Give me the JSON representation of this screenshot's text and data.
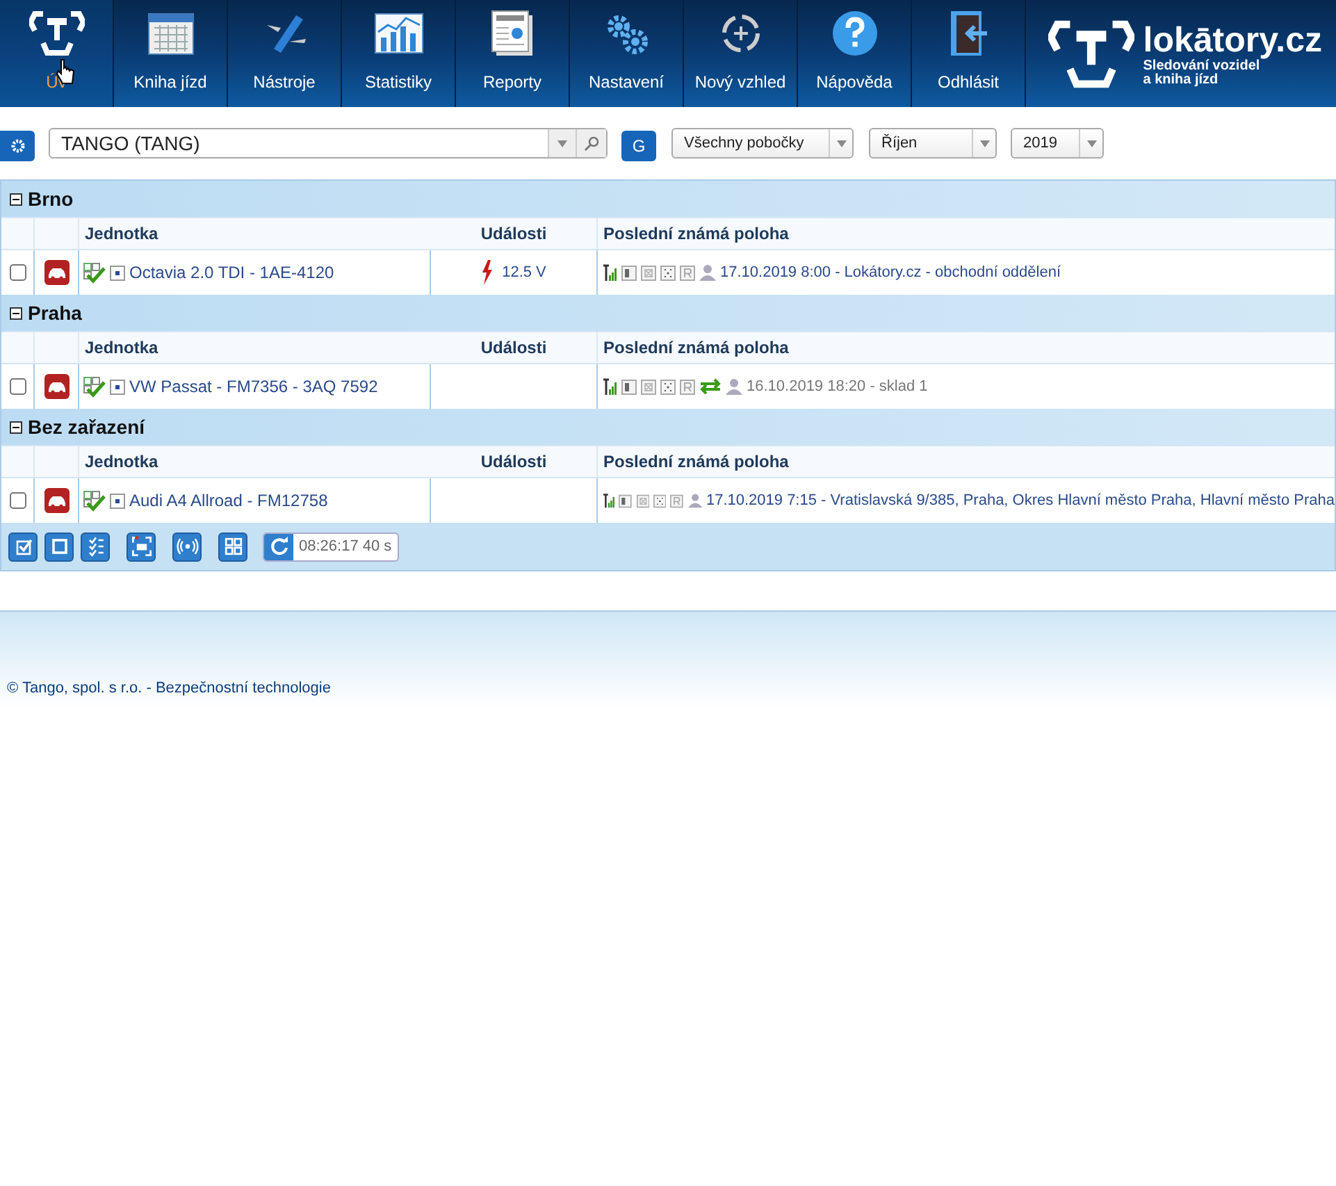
{
  "nav": [
    {
      "label": "Úv",
      "selected": true
    },
    {
      "label": "Kniha jízd",
      "selected": false
    },
    {
      "label": "Nástroje",
      "selected": false
    },
    {
      "label": "Statistiky",
      "selected": false
    },
    {
      "label": "Reporty",
      "selected": false
    },
    {
      "label": "Nastavení",
      "selected": false
    },
    {
      "label": "Nový vzhled",
      "selected": false
    },
    {
      "label": "Nápověda",
      "selected": false
    },
    {
      "label": "Odhlásit",
      "selected": false
    }
  ],
  "logo": {
    "name": "lokātory.cz",
    "tagline": [
      "Sledování vozidel",
      "a kniha jízd"
    ]
  },
  "filters": {
    "unit": "TANGO (TANG)",
    "g_button": "G",
    "branch": "Všechny pobočky",
    "month": "Říjen",
    "year": "2019"
  },
  "groups": [
    {
      "name": "Brno",
      "columns": [
        "Jednotka",
        "Události",
        "Poslední známá poloha"
      ],
      "rows": [
        {
          "checked": false,
          "unit": "Octavia 2.0 TDI - 1AE-4120",
          "event": {
            "kind": "voltage",
            "text": "12.5 V"
          },
          "transfer": false,
          "stale": false,
          "location": "17.10.2019 8:00 - Lokátory.cz - obchodní oddělení"
        }
      ]
    },
    {
      "name": "Praha",
      "columns": [
        "Jednotka",
        "Události",
        "Poslední známá poloha"
      ],
      "rows": [
        {
          "checked": false,
          "unit": "VW Passat - FM7356 - 3AQ 7592",
          "transfer": true,
          "stale": true,
          "location": "16.10.2019 18:20 - sklad 1"
        }
      ]
    },
    {
      "name": "Bez zařazení",
      "columns": [
        "Jednotka",
        "Události",
        "Poslední známá poloha"
      ],
      "rows": [
        {
          "checked": false,
          "unit": "Audi A4 Allroad - FM12758",
          "transfer": false,
          "stale": false,
          "location": "17.10.2019 7:15 - Vratislavská 9/385, Praha, Okres Hlavní město Praha, Hlavní město Praha"
        }
      ]
    }
  ],
  "toolbar": {
    "time": "08:26:17",
    "interval": "40 s"
  },
  "footer": "© Tango, spol. s r.o. - Bezpečnostní technologie"
}
